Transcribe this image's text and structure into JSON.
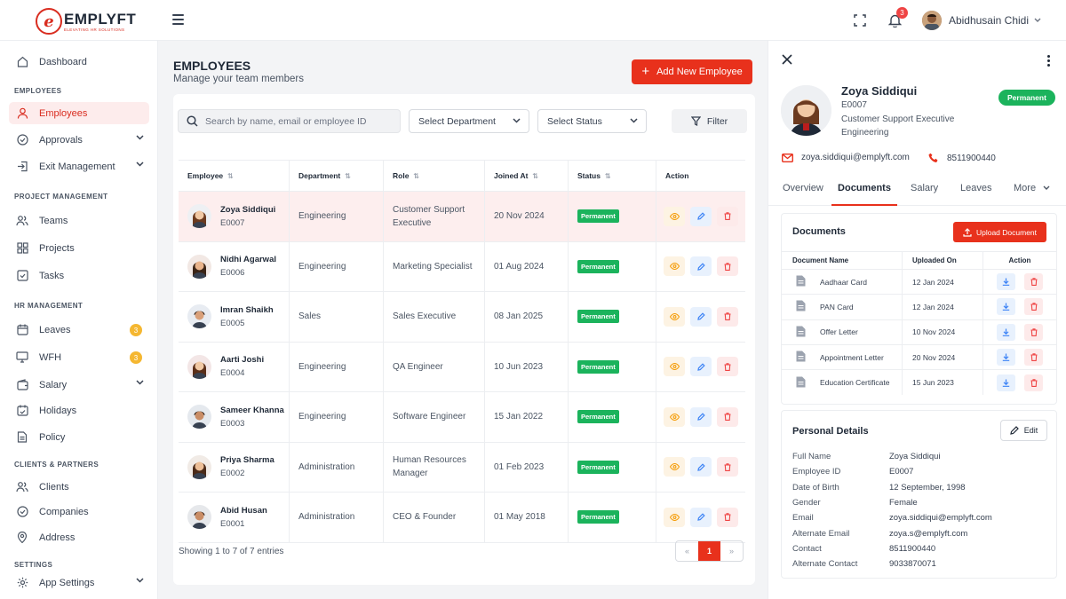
{
  "brand": {
    "mark": "e",
    "name": "EMPLYFT",
    "tagline": "ELEVATING HR SOLUTIONS"
  },
  "topbar": {
    "notification_count": "3",
    "user_name": "Abidhusain Chidi",
    "icons": [
      "hamburger-icon",
      "fullscreen-icon",
      "bell-icon",
      "chevron-down-icon"
    ]
  },
  "sidebar": {
    "dashboard": "Dashboard",
    "sec_employees": "EMPLOYEES",
    "employees": "Employees",
    "approvals": "Approvals",
    "exit_management": "Exit Management",
    "sec_project": "PROJECT MANAGEMENT",
    "teams": "Teams",
    "projects": "Projects",
    "tasks": "Tasks",
    "sec_hr": "HR MANAGEMENT",
    "leaves": "Leaves",
    "leaves_badge": "3",
    "wfh": "WFH",
    "wfh_badge": "3",
    "salary": "Salary",
    "holidays": "Holidays",
    "policy": "Policy",
    "sec_clients": "CLIENTS & PARTNERS",
    "clients": "Clients",
    "companies": "Companies",
    "address": "Address",
    "sec_settings": "SETTINGS",
    "app_settings": "App Settings"
  },
  "main": {
    "title": "EMPLOYEES",
    "subtitle": "Manage your team members",
    "add_button": "Add New Employee",
    "search_placeholder": "Search by name, email or employee ID",
    "department_select": "Select Department",
    "status_select": "Select Status",
    "filter_button": "Filter",
    "columns": [
      "Employee",
      "Department",
      "Role",
      "Joined At",
      "Status",
      "Action"
    ],
    "rows": [
      {
        "name": "Zoya Siddiqui",
        "id": "E0007",
        "department": "Engineering",
        "role": "Customer Support Executive",
        "joined": "20 Nov 2024",
        "status": "Permanent"
      },
      {
        "name": "Nidhi Agarwal",
        "id": "E0006",
        "department": "Engineering",
        "role": "Marketing Specialist",
        "joined": "01 Aug 2024",
        "status": "Permanent"
      },
      {
        "name": "Imran Shaikh",
        "id": "E0005",
        "department": "Sales",
        "role": "Sales Executive",
        "joined": "08 Jan 2025",
        "status": "Permanent"
      },
      {
        "name": "Aarti Joshi",
        "id": "E0004",
        "department": "Engineering",
        "role": "QA Engineer",
        "joined": "10 Jun 2023",
        "status": "Permanent"
      },
      {
        "name": "Sameer Khanna",
        "id": "E0003",
        "department": "Engineering",
        "role": "Software Engineer",
        "joined": "15 Jan 2022",
        "status": "Permanent"
      },
      {
        "name": "Priya Sharma",
        "id": "E0002",
        "department": "Administration",
        "role": "Human Resources Manager",
        "joined": "01 Feb 2023",
        "status": "Permanent"
      },
      {
        "name": "Abid Husan",
        "id": "E0001",
        "department": "Administration",
        "role": "CEO & Founder",
        "joined": "01 May 2018",
        "status": "Permanent"
      }
    ],
    "showing": "Showing 1 to 7 of 7 entries",
    "pager": {
      "prev": "«",
      "current": "1",
      "next": "»"
    }
  },
  "panel": {
    "name": "Zoya Siddiqui",
    "id": "E0007",
    "role": "Customer Support Executive",
    "department": "Engineering",
    "status": "Permanent",
    "email": "zoya.siddiqui@emplyft.com",
    "phone": "8511900440",
    "tabs": [
      "Overview",
      "Documents",
      "Salary",
      "Leaves",
      "More"
    ],
    "active_tab": "Documents",
    "documents": {
      "title": "Documents",
      "upload_button": "Upload Document",
      "columns": [
        "Document Name",
        "Uploaded On",
        "Action"
      ],
      "rows": [
        {
          "name": "Aadhaar Card",
          "date": "12 Jan 2024"
        },
        {
          "name": "PAN Card",
          "date": "12 Jan 2024"
        },
        {
          "name": "Offer Letter",
          "date": "10 Nov 2024"
        },
        {
          "name": "Appointment Letter",
          "date": "20 Nov 2024"
        },
        {
          "name": "Education Certificate",
          "date": "15 Jun 2023"
        }
      ]
    },
    "personal": {
      "title": "Personal Details",
      "edit_button": "Edit",
      "fields": [
        {
          "label": "Full Name",
          "value": "Zoya Siddiqui"
        },
        {
          "label": "Employee ID",
          "value": "E0007"
        },
        {
          "label": "Date of Birth",
          "value": "12 September, 1998"
        },
        {
          "label": "Gender",
          "value": "Female"
        },
        {
          "label": "Email",
          "value": "zoya.siddiqui@emplyft.com"
        },
        {
          "label": "Alternate Email",
          "value": "zoya.s@emplyft.com"
        },
        {
          "label": "Contact",
          "value": "8511900440"
        },
        {
          "label": "Alternate Contact",
          "value": "9033870071"
        }
      ]
    }
  },
  "colors": {
    "accent": "#e8311c",
    "success": "#1bb35c",
    "active_bg": "#fdecec",
    "badge": "#f5b731"
  }
}
